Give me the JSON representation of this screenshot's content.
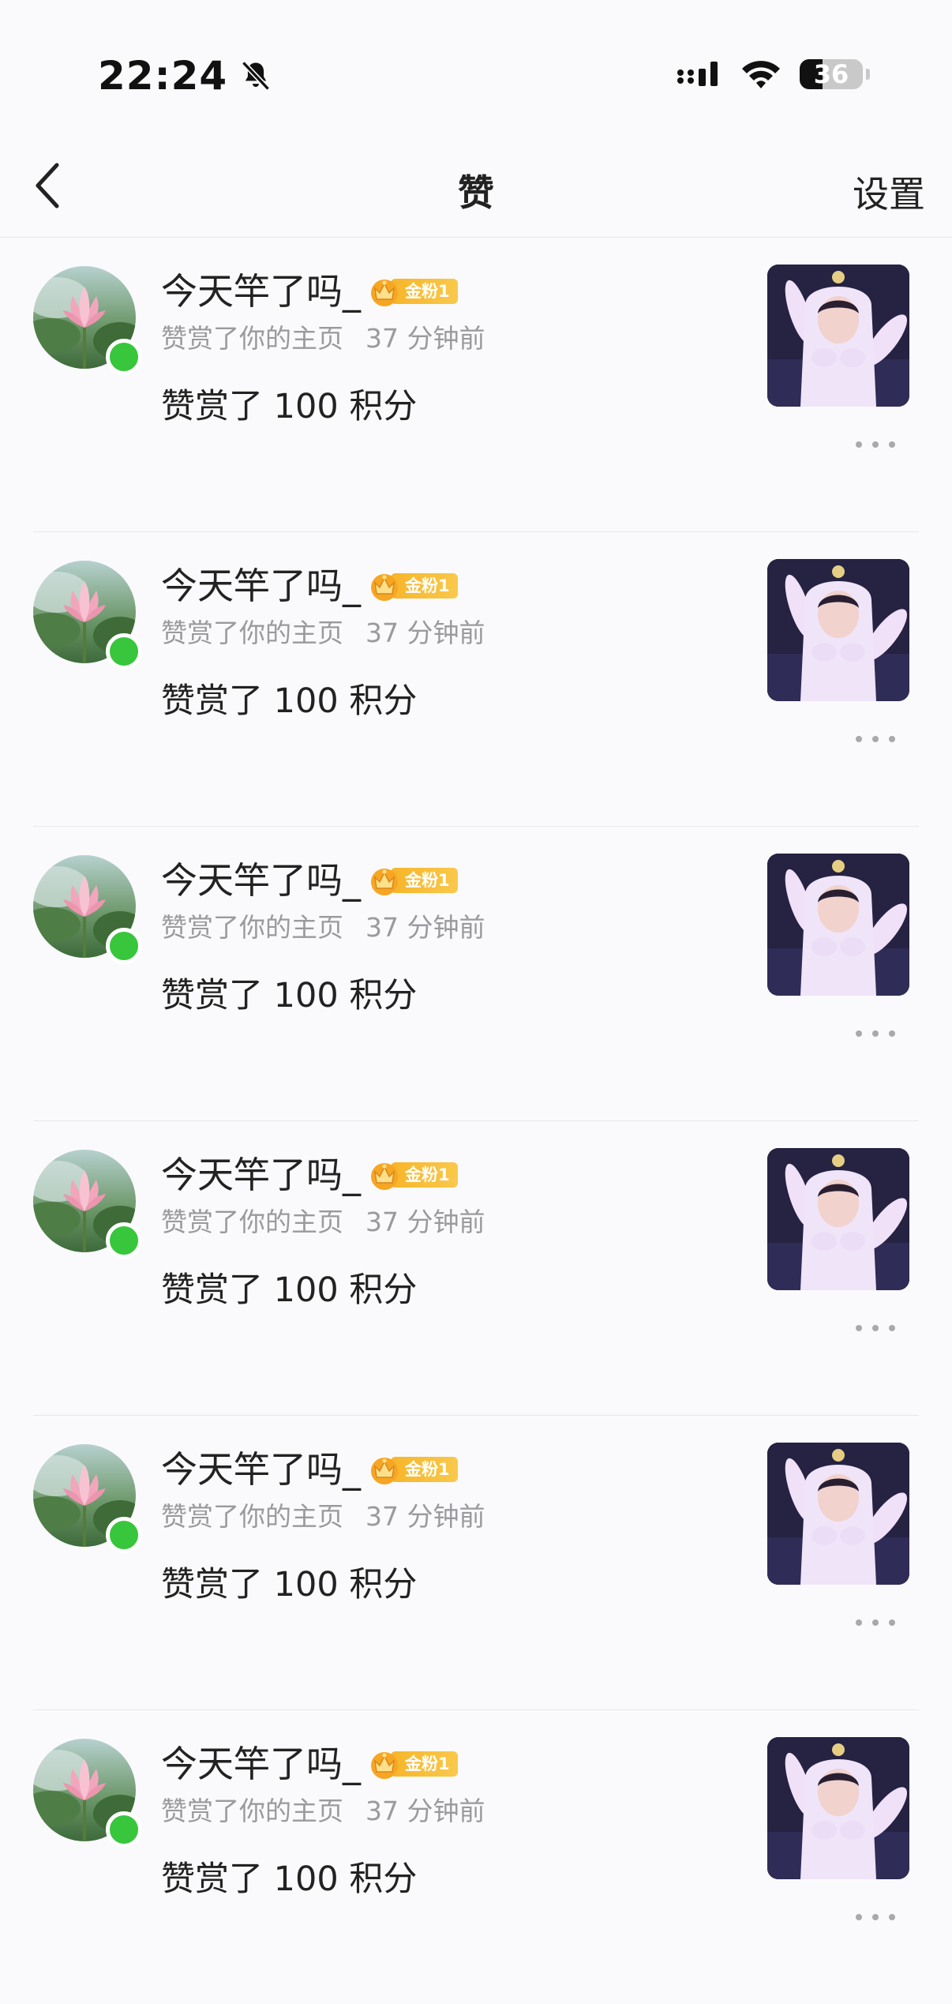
{
  "status_bar": {
    "time": "22:24",
    "battery": 36,
    "battery_label": "36",
    "icons": [
      "bell-muted-icon",
      "signal-icon",
      "wifi-icon",
      "battery-icon"
    ]
  },
  "nav": {
    "back_icon": "chevron-left-icon",
    "title": "赞",
    "settings_label": "设置"
  },
  "notifications": [
    {
      "username": "今天竿了吗_",
      "badge": "金粉1",
      "action": "赞赏了你的主页",
      "time_ago": "37 分钟前",
      "content": "赞赏了 100 积分",
      "online": true
    },
    {
      "username": "今天竿了吗_",
      "badge": "金粉1",
      "action": "赞赏了你的主页",
      "time_ago": "37 分钟前",
      "content": "赞赏了 100 积分",
      "online": true
    },
    {
      "username": "今天竿了吗_",
      "badge": "金粉1",
      "action": "赞赏了你的主页",
      "time_ago": "37 分钟前",
      "content": "赞赏了 100 积分",
      "online": true
    },
    {
      "username": "今天竿了吗_",
      "badge": "金粉1",
      "action": "赞赏了你的主页",
      "time_ago": "37 分钟前",
      "content": "赞赏了 100 积分",
      "online": true
    },
    {
      "username": "今天竿了吗_",
      "badge": "金粉1",
      "action": "赞赏了你的主页",
      "time_ago": "37 分钟前",
      "content": "赞赏了 100 积分",
      "online": true
    },
    {
      "username": "今天竿了吗_",
      "badge": "金粉1",
      "action": "赞赏了你的主页",
      "time_ago": "37 分钟前",
      "content": "赞赏了 100 积分",
      "online": true
    }
  ],
  "colors": {
    "online": "#37c63c",
    "badge": "#f7b52a",
    "meta_text": "#9a9a9e",
    "background": "#fafafc"
  }
}
